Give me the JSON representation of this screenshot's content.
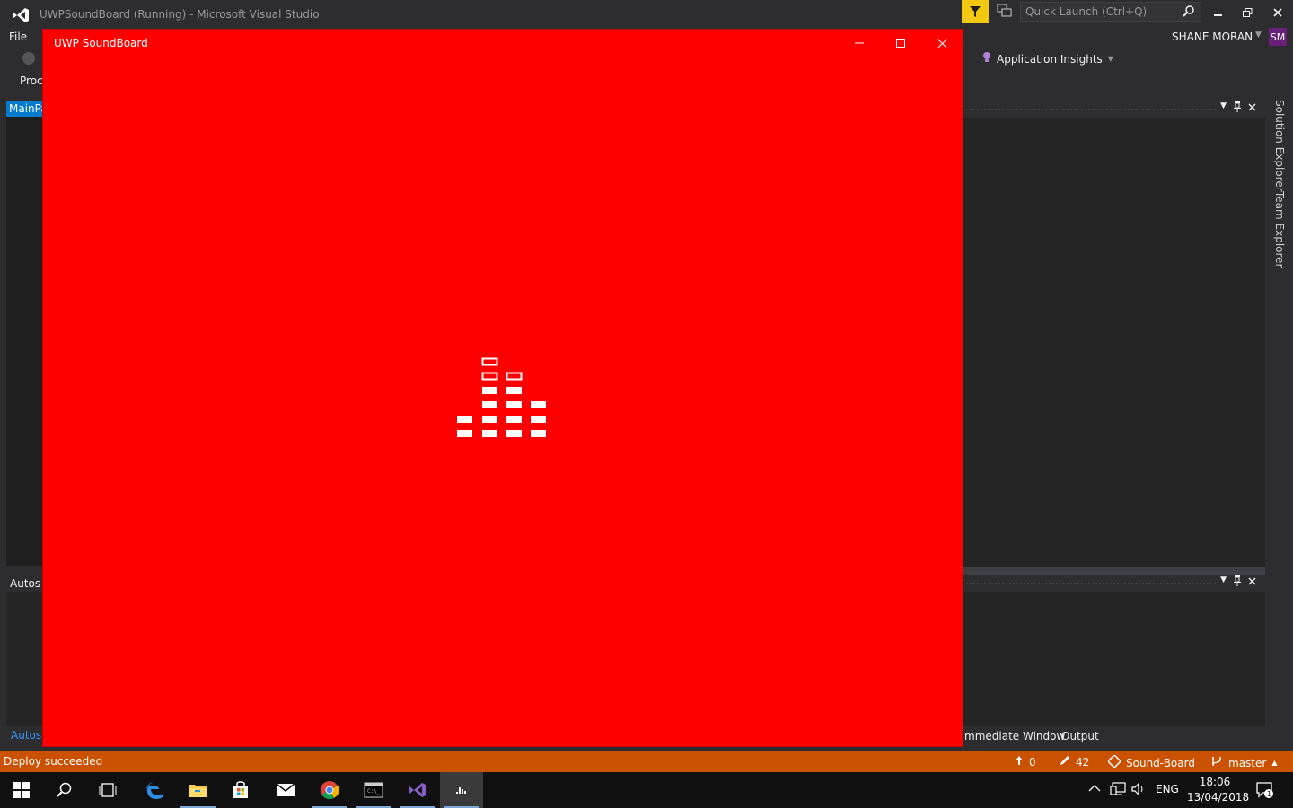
{
  "vs": {
    "title": "UWPSoundBoard (Running) - Microsoft Visual Studio",
    "quick_launch_placeholder": "Quick Launch (Ctrl+Q)",
    "menu_file": "File",
    "user_name": "SHANE MORAN",
    "user_initials": "SM",
    "toolbar_proc": "Proc",
    "app_insights": "Application Insights",
    "doc_tab": "MainPa",
    "side_tabs": [
      "Solution Explorer",
      "Team Explorer"
    ],
    "autos_header": "Autos",
    "autos_tab": "Autos",
    "bottom_tabs": [
      "mmediate Window",
      "Output"
    ],
    "accent": "#007acc"
  },
  "uwp": {
    "title": "UWP SoundBoard",
    "background": "#ff0000"
  },
  "status": {
    "message": "Deploy succeeded",
    "push_count": "0",
    "changes_count": "42",
    "repo": "Sound-Board",
    "branch": "master",
    "color": "#ca5100"
  },
  "taskbar": {
    "ime": "ENG",
    "time": "18:06",
    "date": "13/04/2018",
    "notifications": "1"
  }
}
